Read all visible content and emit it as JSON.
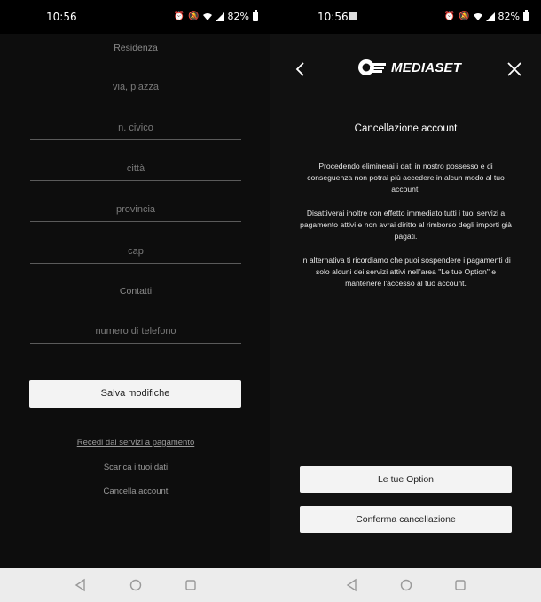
{
  "left": {
    "status": {
      "time": "10:56",
      "battery": "82%"
    },
    "form": {
      "section_residenza": "Residenza",
      "via_placeholder": "via, piazza",
      "civico_placeholder": "n. civico",
      "citta_placeholder": "città",
      "provincia_placeholder": "provincia",
      "cap_placeholder": "cap",
      "section_contatti": "Contatti",
      "telefono_placeholder": "numero di telefono"
    },
    "save_label": "Salva modifiche",
    "links": {
      "recedi": "Recedi dai servizi a pagamento",
      "scarica": "Scarica i tuoi dati",
      "cancella": "Cancella account"
    }
  },
  "right": {
    "status": {
      "time": "10:56",
      "battery": "82%"
    },
    "logo_text": "MEDIASET",
    "title": "Cancellazione account",
    "paragraphs": [
      "Procedendo eliminerai i dati in nostro possesso e di conseguenza non potrai più accedere in alcun modo al tuo account.",
      "Disattiverai inoltre con effetto immediato tutti i tuoi servizi a pagamento attivi e non avrai diritto al rimborso degli importi già pagati.",
      "In alternativa ti ricordiamo che puoi sospendere i pagamenti di solo alcuni dei servizi attivi nell'area \"Le tue Option\" e mantenere l'accesso al tuo account."
    ],
    "option_button": "Le tue Option",
    "confirm_button": "Conferma cancellazione"
  },
  "icons": {
    "status": [
      "alarm-icon",
      "mute-icon",
      "wifi-icon",
      "signal-icon",
      "battery-icon"
    ],
    "nav": [
      "back-triangle-icon",
      "home-circle-icon",
      "recents-square-icon"
    ]
  },
  "colors": {
    "background": "#0d0d0d",
    "button": "#f3f3f3",
    "navbar": "#ececec"
  }
}
